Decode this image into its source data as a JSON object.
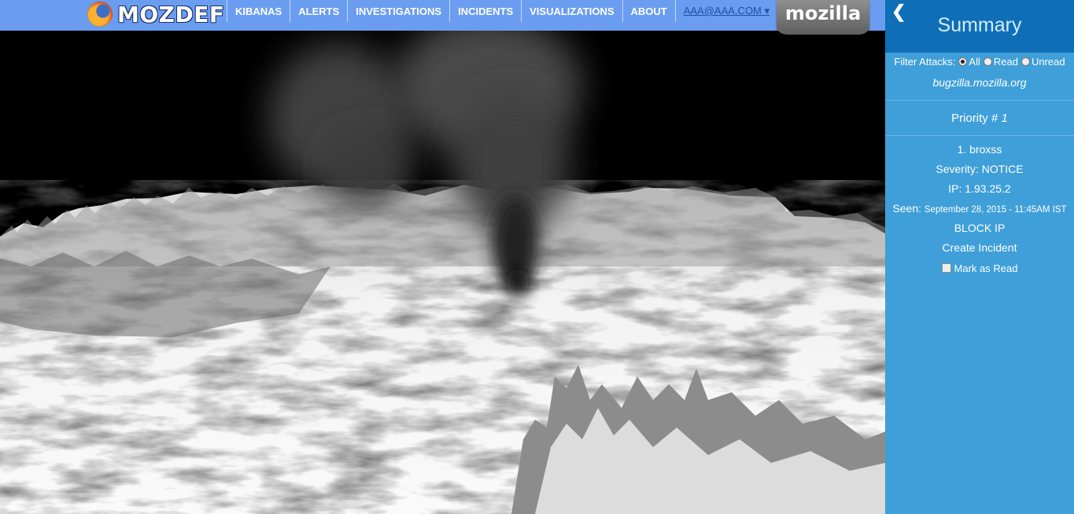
{
  "header": {
    "brand": "MOZDEF",
    "nav": [
      "KIBANAS",
      "ALERTS",
      "INVESTIGATIONS",
      "INCIDENTS",
      "VISUALIZATIONS",
      "ABOUT"
    ],
    "user": "AAA@AAA.COM ▾",
    "mozilla_tab": "mozilla"
  },
  "sidebar": {
    "back_icon": "chevron-left-icon",
    "title": "Summary",
    "filter_label": "Filter Attacks:",
    "filter_options": [
      "All",
      "Read",
      "Unread"
    ],
    "filter_selected": "All",
    "host": "bugzilla.mozilla.org",
    "priority_label": "Priority #",
    "priority_value": "1",
    "attack_name": "1. broxss",
    "severity": "Severity: NOTICE",
    "ip": "IP: 1.93.25.2",
    "seen_label": "Seen:",
    "seen_date": "September 28, 2015 - 11:45AM IST",
    "block_ip": "BLOCK IP",
    "create_incident": "Create Incident",
    "mark_read": "Mark as Read",
    "mark_read_checked": false
  },
  "colors": {
    "navbar": "#6a9df0",
    "sidebar": "#3f9fd9",
    "sidebar_header": "#0e6fb7",
    "scene_background": "#000000",
    "terrain": "#f2f2f2",
    "smoke": "#2a2a2a"
  }
}
